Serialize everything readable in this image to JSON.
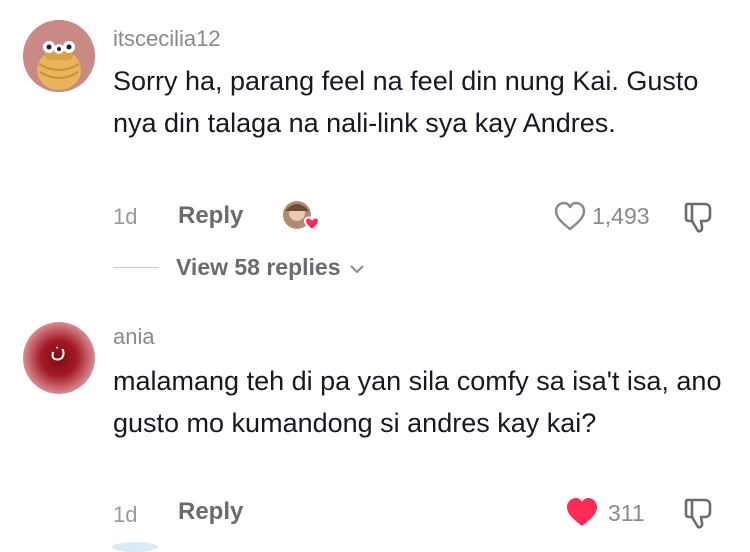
{
  "colors": {
    "liked_heart": "#fe2c55",
    "secondary_text": "#8a8a8e"
  },
  "comments": [
    {
      "username": "itscecilia12",
      "text": "Sorry ha, parang feel na feel din nung Kai. Gusto nya din talaga na nali-link sya kay Andres.",
      "time": "1d",
      "reply_label": "Reply",
      "likes": "1,493",
      "liked": false,
      "creator_liked": true,
      "view_replies": "View 58 replies"
    },
    {
      "username": "ania",
      "avatar_glyph": "ن",
      "text": "malamang teh di pa yan sila comfy sa isa't isa, ano gusto mo kumandong si andres kay kai?",
      "time": "1d",
      "reply_label": "Reply",
      "likes": "311",
      "liked": true
    }
  ]
}
